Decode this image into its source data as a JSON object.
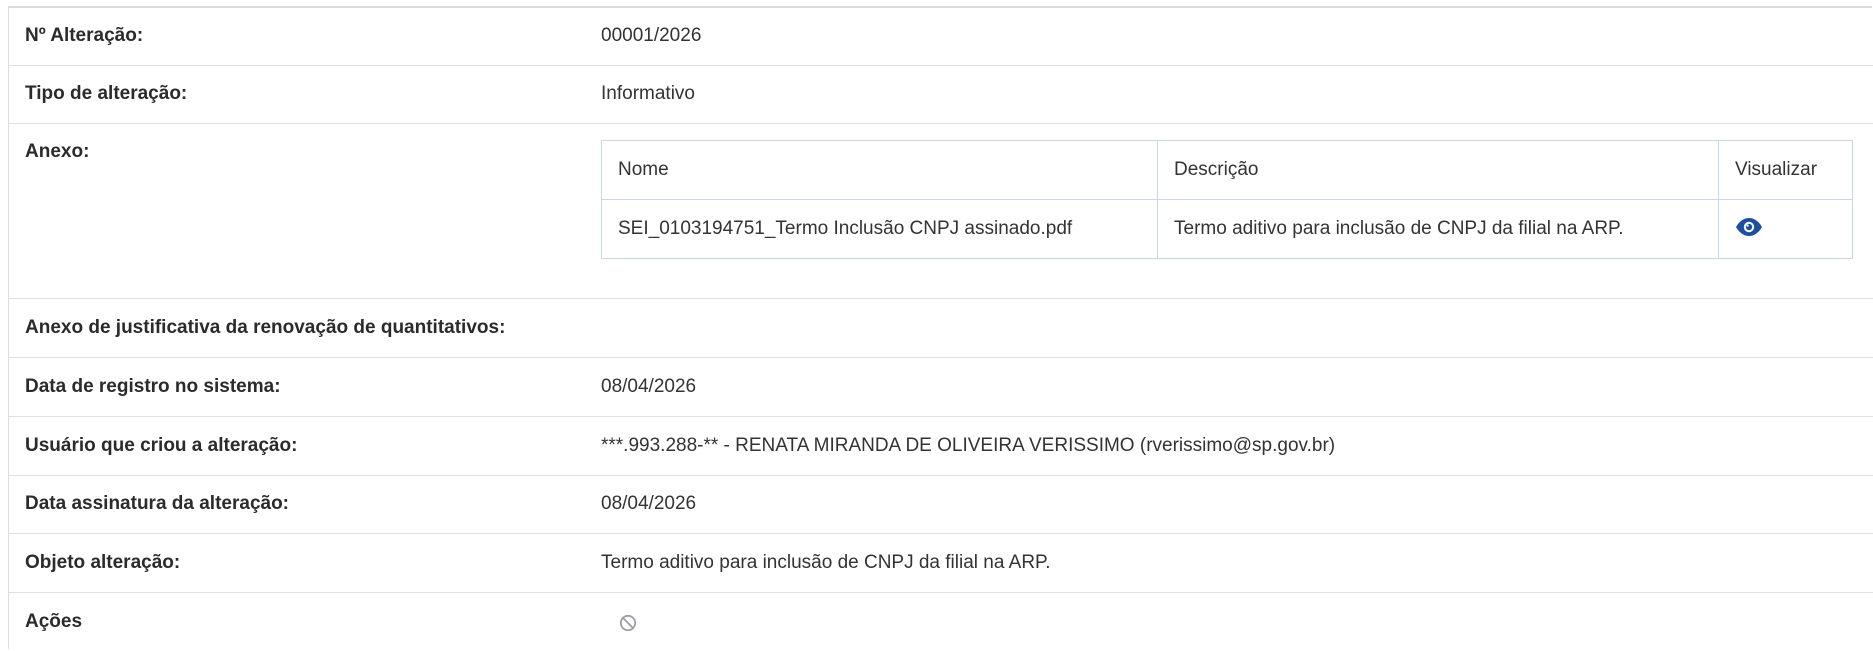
{
  "rows": {
    "numero": {
      "label": "Nº Alteração:",
      "value": "00001/2026"
    },
    "tipo": {
      "label": "Tipo de alteração:",
      "value": "Informativo"
    },
    "anexo": {
      "label": "Anexo:",
      "table": {
        "headers": [
          "Nome",
          "Descrição",
          "Visualizar"
        ],
        "rows": [
          {
            "nome": "SEI_0103194751_Termo Inclusão CNPJ assinado.pdf",
            "descricao": "Termo aditivo para inclusão de CNPJ da filial na ARP.",
            "visualizar_icon": "eye-icon"
          }
        ]
      }
    },
    "anexo_justificativa": {
      "label": "Anexo de justificativa da renovação de quantitativos:",
      "value": ""
    },
    "data_registro": {
      "label": "Data de registro no sistema:",
      "value": "08/04/2026"
    },
    "usuario": {
      "label": "Usuário que criou a alteração:",
      "value": "***.993.288-** - RENATA MIRANDA DE OLIVEIRA VERISSIMO (rverissimo@sp.gov.br)"
    },
    "data_assinatura": {
      "label": "Data assinatura da alteração:",
      "value": "08/04/2026"
    },
    "objeto": {
      "label": "Objeto alteração:",
      "value": "Termo aditivo para inclusão de CNPJ da filial na ARP."
    },
    "acoes": {
      "label": "Ações",
      "icon": "ban-icon"
    }
  },
  "colors": {
    "border": "#dde1e6",
    "table_border": "#c9d7e6",
    "eye_icon": "#1c4fa0",
    "ban_icon": "#9aa0a6"
  }
}
